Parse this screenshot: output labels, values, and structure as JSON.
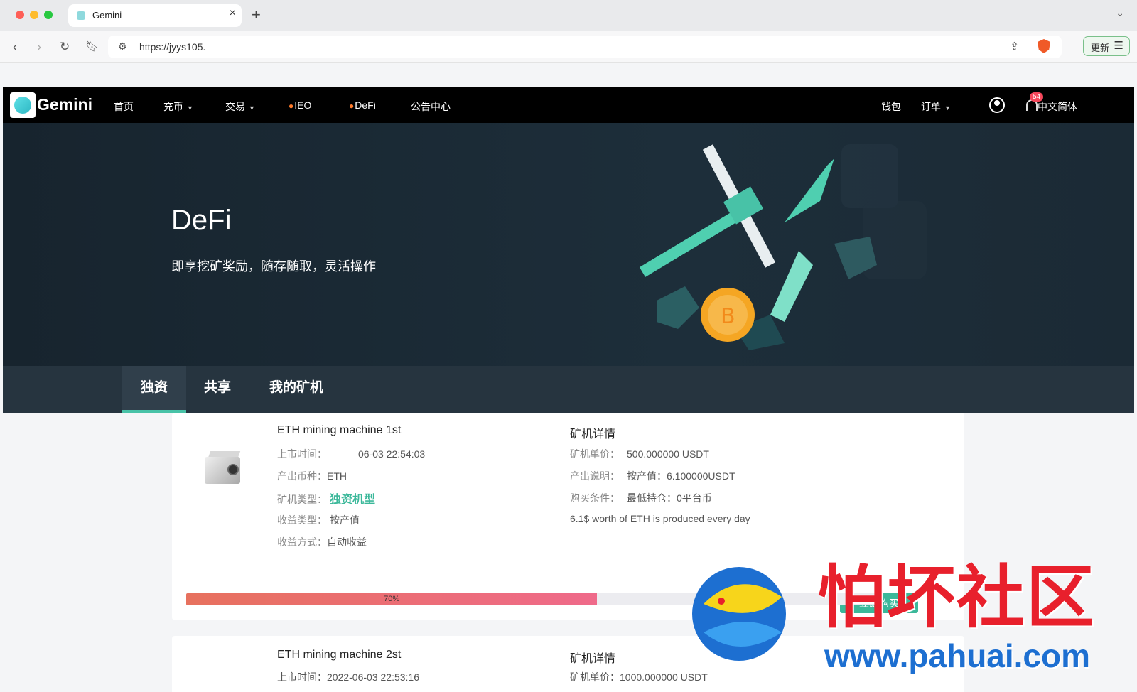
{
  "browser": {
    "tab_title": "Gemini",
    "tab_close": "×",
    "new_tab": "+",
    "url": "https://jyys105.",
    "update_label": "更新"
  },
  "nav": {
    "brand": "Gemini",
    "items": [
      "首页",
      "充币",
      "交易",
      "IEO",
      "DeFi",
      "公告中心"
    ],
    "right": {
      "wallet": "钱包",
      "orders": "订单",
      "notifications": "54",
      "language": "中文简体"
    }
  },
  "hero": {
    "title": "DeFi",
    "subtitle": "即享挖矿奖励，随存随取，灵活操作"
  },
  "tabs": [
    "独资",
    "共享",
    "我的矿机"
  ],
  "cards": [
    {
      "name": "ETH mining machine 1st",
      "listed_label": "上市时间：",
      "listed_value": "06-03 22:54:03",
      "coin_label": "产出币种：",
      "coin_value": "ETH",
      "type_label": "矿机类型：",
      "type_value": "独资机型",
      "income_type_label": "收益类型：",
      "income_type_value": "按产值",
      "income_method_label": "收益方式：",
      "income_method_value": "自动收益",
      "detail_title": "矿机详情",
      "price_label": "矿机单价：",
      "price_value": "500.000000 USDT",
      "output_label": "产出说明：",
      "output_value": "按产值：6.100000USDT",
      "condition_label": "购买条件：",
      "condition_value": "最低持仓：0平台币",
      "note": "6.1$ worth of ETH is produced every day",
      "progress": 0.7,
      "progress_label": "70%",
      "buy_label": "立即购买"
    },
    {
      "name": "ETH mining machine 2st",
      "detail_title": "矿机详情",
      "listed_value_partial": "上市时间：2022-06-03 22:53:16",
      "price_value_partial": "矿机单价：1000.000000 USDT"
    }
  ],
  "watermark": {
    "cn": "怕坏社区",
    "url": "www.pahuai.com"
  },
  "colors": {
    "accent": "#3bb89a",
    "badge": "#f5475b",
    "progress": "#e7715e",
    "watermark_red": "#e8202c",
    "watermark_blue": "#1d6fd1"
  }
}
